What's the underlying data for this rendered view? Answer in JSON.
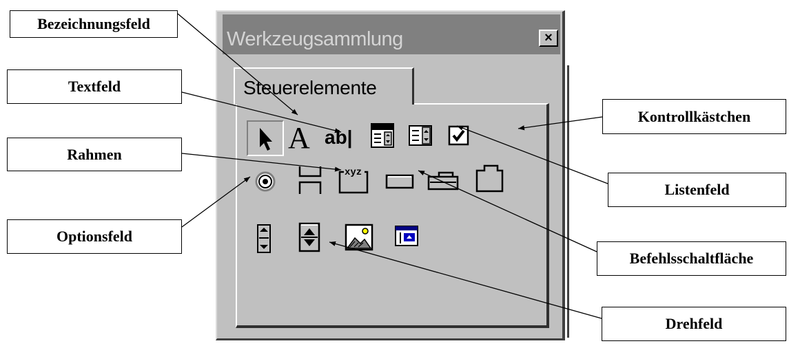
{
  "window": {
    "title": "Werkzeugsammlung",
    "close_label": "×",
    "tab_label": "Steuerelemente"
  },
  "tools": [
    {
      "name": "pointer-tool",
      "icon": "arrow-pointer-icon"
    },
    {
      "name": "label-tool",
      "icon": "letter-a-icon",
      "glyph": "A"
    },
    {
      "name": "textbox-tool",
      "icon": "ab-text-icon",
      "glyph": "ab|"
    },
    {
      "name": "combobox-tool",
      "icon": "combobox-icon"
    },
    {
      "name": "listbox-tool",
      "icon": "listbox-icon"
    },
    {
      "name": "checkbox-tool",
      "icon": "checkbox-icon"
    },
    {
      "name": "optionbutton-tool",
      "icon": "radio-button-icon"
    },
    {
      "name": "togglebutton-tool",
      "icon": "toggle-button-icon"
    },
    {
      "name": "frame-tool",
      "icon": "frame-xyz-icon",
      "glyph": "xyz"
    },
    {
      "name": "commandbutton-tool",
      "icon": "command-button-icon"
    },
    {
      "name": "tabstrip-tool",
      "icon": "tabstrip-icon"
    },
    {
      "name": "multipage-tool",
      "icon": "multipage-icon"
    },
    {
      "name": "scrollbar-tool",
      "icon": "scrollbar-icon"
    },
    {
      "name": "spinbutton-tool",
      "icon": "spin-button-icon"
    },
    {
      "name": "image-tool",
      "icon": "image-icon"
    },
    {
      "name": "refedit-tool",
      "icon": "refedit-icon"
    }
  ],
  "callouts": {
    "bezeichnungsfeld": "Bezeichnungsfeld",
    "textfeld": "Textfeld",
    "rahmen": "Rahmen",
    "optionsfeld": "Optionsfeld",
    "kontrollkaestchen": "Kontrollkästchen",
    "listenfeld": "Listenfeld",
    "befehlsschaltflaeche": "Befehlsschaltfläche",
    "drehfeld": "Drehfeld"
  },
  "colors": {
    "window_bg": "#c0c0c0",
    "titlebar_bg": "#808080",
    "title_text": "#d4d4d4",
    "icon_blue": "#000080",
    "line": "#000000"
  }
}
